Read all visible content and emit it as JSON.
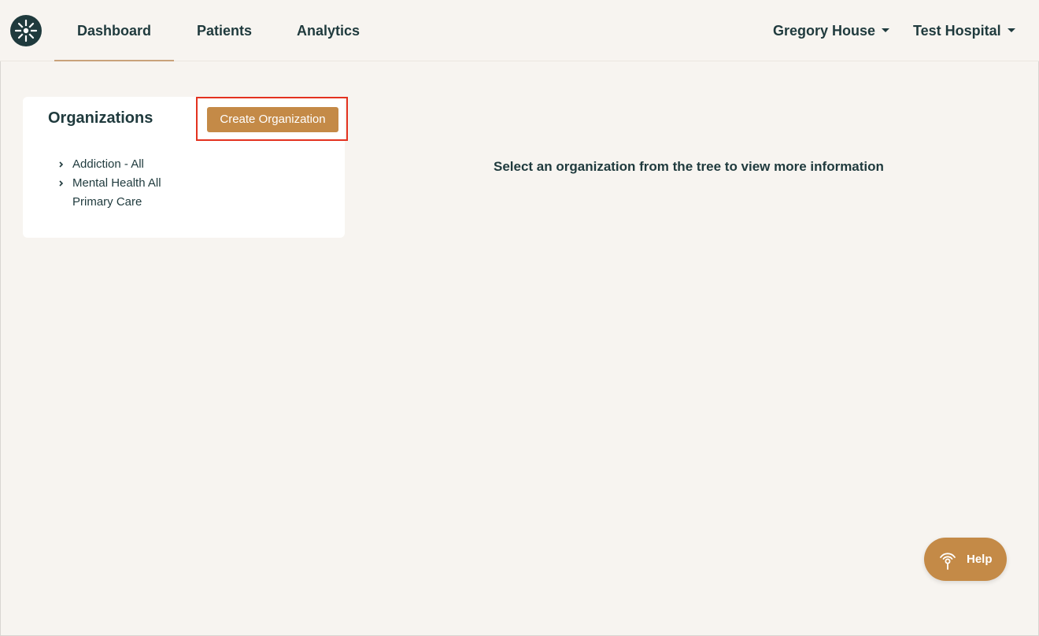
{
  "header": {
    "logo_icon": "snowflake-star-logo",
    "tabs": [
      {
        "label": "Dashboard",
        "active": true
      },
      {
        "label": "Patients",
        "active": false
      },
      {
        "label": "Analytics",
        "active": false
      }
    ],
    "user_menu": "Gregory House",
    "hospital_menu": "Test Hospital"
  },
  "organizations": {
    "title": "Organizations",
    "create_button": "Create Organization",
    "tree": [
      {
        "label": "Addiction - All",
        "expandable": true
      },
      {
        "label": "Mental Health All",
        "expandable": true
      },
      {
        "label": "Primary Care",
        "expandable": false
      }
    ]
  },
  "main": {
    "empty_message": "Select an organization from the tree to view more information"
  },
  "help": {
    "label": "Help",
    "icon": "signal-broadcast-icon"
  },
  "colors": {
    "primary_text": "#1f3a3d",
    "accent": "#c48a47",
    "highlight_border": "#e3321f",
    "background": "#f7f4f0"
  }
}
